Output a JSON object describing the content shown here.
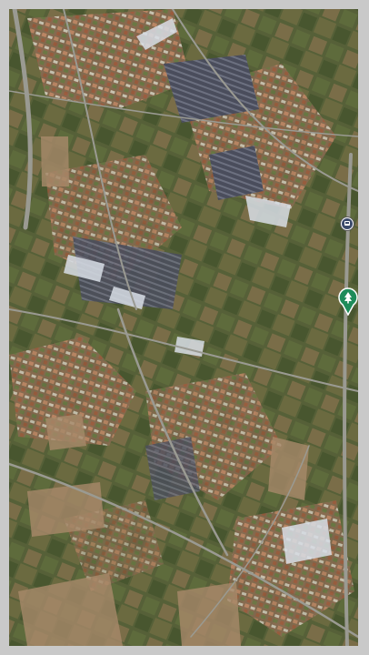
{
  "map": {
    "view": "aerial-3d",
    "markers": [
      {
        "icon": "bus-stop-icon",
        "color": "#3b4a6b"
      },
      {
        "icon": "park-pin-icon",
        "color": "#1e8c5a"
      }
    ]
  }
}
